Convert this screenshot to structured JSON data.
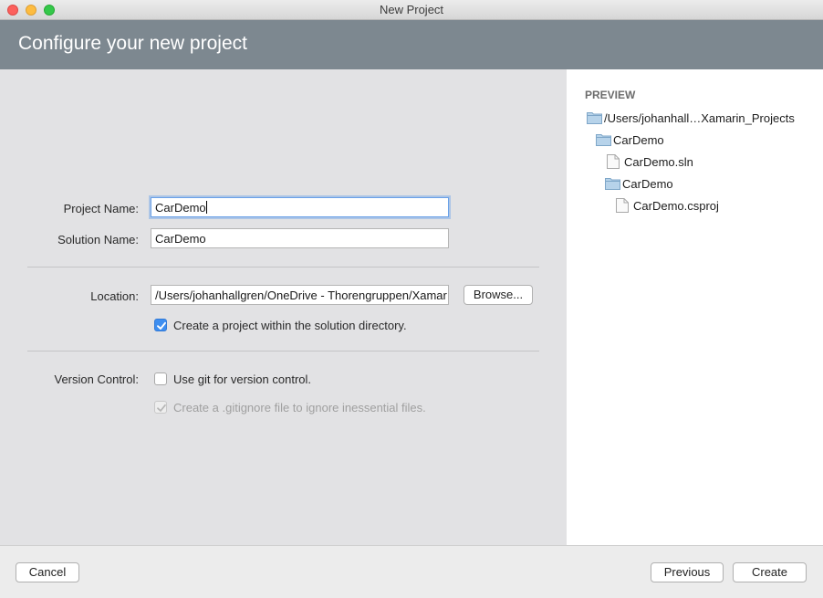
{
  "window": {
    "title": "New Project"
  },
  "header": {
    "title": "Configure your new project"
  },
  "form": {
    "project_name_label": "Project Name:",
    "project_name_value": "CarDemo",
    "solution_name_label": "Solution Name:",
    "solution_name_value": "CarDemo",
    "location_label": "Location:",
    "location_value": "/Users/johanhallgren/OneDrive - Thorengruppen/Xamar",
    "browse_label": "Browse...",
    "create_within_dir": {
      "label": "Create a project within the solution directory.",
      "checked": true
    },
    "version_control_label": "Version Control:",
    "use_git": {
      "label": "Use git for version control.",
      "checked": false
    },
    "gitignore": {
      "label": "Create a .gitignore file to ignore inessential files.",
      "checked": true,
      "disabled": true
    }
  },
  "preview": {
    "title": "PREVIEW",
    "tree": [
      {
        "name": "/Users/johanhall…Xamarin_Projects",
        "type": "folder-icon"
      },
      {
        "name": "CarDemo",
        "type": "folder-icon"
      },
      {
        "name": "CarDemo.sln",
        "type": "file-icon"
      },
      {
        "name": "CarDemo",
        "type": "folder-icon"
      },
      {
        "name": "CarDemo.csproj",
        "type": "file-icon"
      }
    ]
  },
  "footer": {
    "cancel_label": "Cancel",
    "previous_label": "Previous",
    "create_label": "Create"
  },
  "colors": {
    "header_bg": "#7d8890",
    "accent": "#3d8ef0",
    "main_bg": "#e2e2e4"
  }
}
